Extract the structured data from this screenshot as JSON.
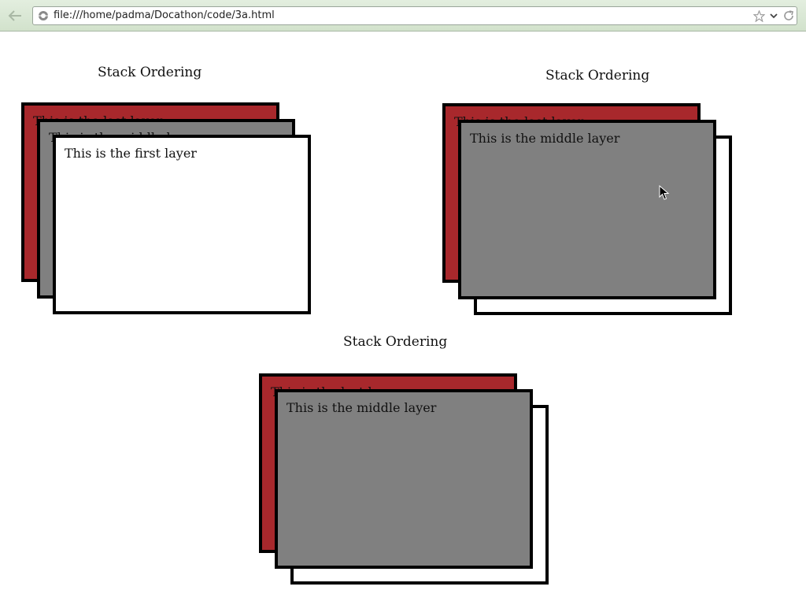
{
  "browser": {
    "url": "file:///home/padma/Docathon/code/3a.html",
    "icons": {
      "back": "back-arrow-icon",
      "site": "globe-icon",
      "bookmark": "star-icon",
      "dropdown": "chevron-down-icon",
      "reload": "reload-icon"
    }
  },
  "demos": [
    {
      "heading": "Stack Ordering",
      "back_text": "This is the last layer",
      "middle_text": "This is the middle layer",
      "front_text": "This is the first layer"
    },
    {
      "heading": "Stack Ordering",
      "back_text": "This is the last layer",
      "middle_text": "This is the middle layer",
      "front_text": ""
    },
    {
      "heading": "Stack Ordering",
      "back_text": "This is the last layer",
      "middle_text": "This is the middle layer",
      "front_text": ""
    }
  ],
  "colors": {
    "back_layer": "#a8282c",
    "middle_layer": "#808080",
    "front_layer": "#ffffff",
    "border": "#000000"
  }
}
